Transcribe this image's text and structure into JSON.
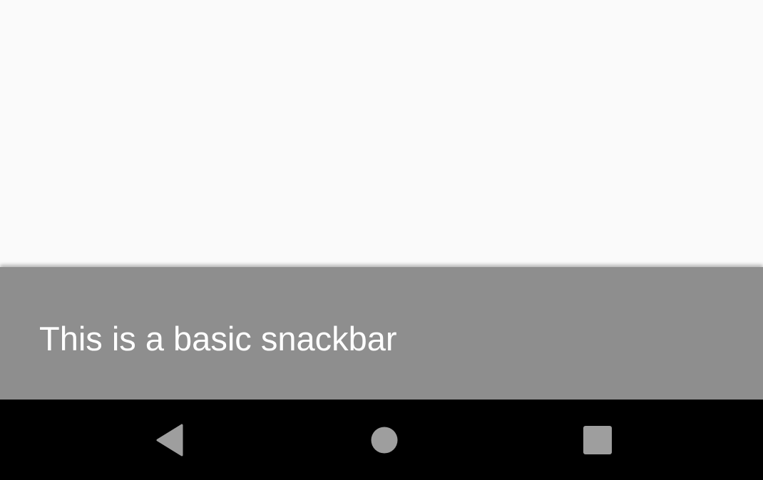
{
  "snackbar": {
    "message": "This is a basic snackbar"
  },
  "navigation_bar": {
    "buttons": [
      {
        "name": "back",
        "icon": "back-triangle-icon"
      },
      {
        "name": "home",
        "icon": "home-circle-icon"
      },
      {
        "name": "recents",
        "icon": "recents-square-icon"
      }
    ],
    "icon_color": "#9e9e9e",
    "background_color": "#000000"
  },
  "colors": {
    "background": "#fafafa",
    "snackbar_background": "#8e8e8e",
    "snackbar_text": "#ffffff"
  }
}
